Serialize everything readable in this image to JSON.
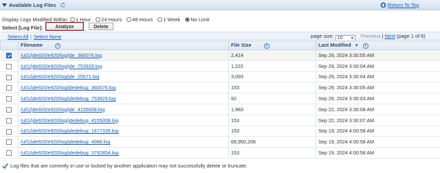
{
  "header": {
    "title": "Available Log Files",
    "return_link": "Return To Top"
  },
  "filter": {
    "label": "Display Logs Modified Within",
    "options": [
      "1 Hour",
      "24 Hours",
      "48 Hours",
      "1 Week",
      "No Limit"
    ],
    "selected": "No Limit"
  },
  "actions": {
    "select_label": "Select [Log File]:",
    "analyze_label": "Analyze",
    "delete_label": "Delete"
  },
  "selection_links": {
    "select_all": "Select All",
    "separator": "|",
    "select_none": "Select None"
  },
  "pager": {
    "page_size_label": "page size:",
    "page_size": "10",
    "previous": "Previous",
    "separator": "|",
    "next": "Next",
    "page_info": "(page 1 of 6)"
  },
  "table": {
    "columns": [
      "Filename",
      "File Size",
      "Last Modified"
    ],
    "rows": [
      {
        "checked": true,
        "filename": "/u01/jde920/e920/log/jde_360076.log",
        "size": "2,414",
        "modified": "Sep 29, 2024 3:30:05 AM"
      },
      {
        "checked": false,
        "filename": "/u01/jde920/e920/log/jde_753929.log",
        "size": "1,222",
        "modified": "Sep 29, 2024 3:30:04 AM"
      },
      {
        "checked": false,
        "filename": "/u01/jde920/e920/log/jde_25571.log",
        "size": "3,093",
        "modified": "Sep 29, 2024 3:30:04 AM"
      },
      {
        "checked": false,
        "filename": "/u01/jde920/e920/log/jdedebug_360076.log",
        "size": "153",
        "modified": "Sep 29, 2024 3:30:05 AM"
      },
      {
        "checked": false,
        "filename": "/u01/jde920/e920/log/jdedebug_753929.log",
        "size": "92",
        "modified": "Sep 29, 2024 3:30:03 AM"
      },
      {
        "checked": false,
        "filename": "/u01/jde920/e920/log/jde_4155008.log",
        "size": "1,983",
        "modified": "Sep 22, 2024 3:30:08 AM"
      },
      {
        "checked": false,
        "filename": "/u01/jde920/e920/log/jdedebug_4155008.log",
        "size": "153",
        "modified": "Sep 22, 2024 3:30:07 AM"
      },
      {
        "checked": false,
        "filename": "/u01/jde920/e920/log/jdedebug_1677335.log",
        "size": "153",
        "modified": "Sep 19, 2024 4:00:58 AM"
      },
      {
        "checked": false,
        "filename": "/u01/jde920/e920/log/jdedebug_4088.log",
        "size": "68,950,206",
        "modified": "Sep 19, 2024 4:00:58 AM"
      },
      {
        "checked": false,
        "filename": "/u01/jde920/e920/log/jdedebug_3792854.log",
        "size": "153",
        "modified": "Sep 19, 2024 4:00:58 AM"
      }
    ]
  },
  "footer": {
    "note": "Log files that are currently in use or locked by another application may not successfully delete or truncate."
  },
  "colors": {
    "link": "#1a5aa8",
    "header_bg": "#d5e2f0",
    "analyze_outline": "#c8102e",
    "checkbox_checked": "#2d6fd0",
    "footer_check": "#3a9a3a"
  },
  "icons": {
    "collapse": "collapse-triangle-icon",
    "refresh": "refresh-icon",
    "return_to_top": "arrow-up-icon",
    "column_info": "info-icon",
    "sort": "sort-descending-icon",
    "footer": "checkmark-icon"
  }
}
